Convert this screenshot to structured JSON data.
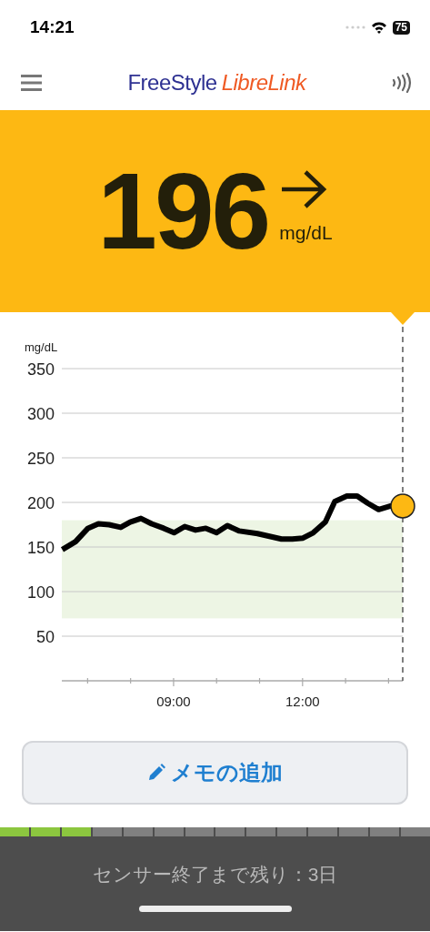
{
  "status_bar": {
    "time": "14:21",
    "battery": "75"
  },
  "header": {
    "logo_primary": "FreeStyle",
    "logo_secondary": "LibreLink"
  },
  "reading": {
    "value": "196",
    "unit": "mg/dL"
  },
  "chart": {
    "chart_data": {
      "type": "line",
      "ylabel": "mg/dL",
      "xlim": [
        6.4,
        14.33
      ],
      "ylim": [
        0,
        350
      ],
      "xticks": [
        {
          "value": 9,
          "label": "09:00"
        },
        {
          "value": 12,
          "label": "12:00"
        }
      ],
      "yticks": [
        50,
        100,
        150,
        200,
        250,
        300,
        350
      ],
      "x": [
        6.41,
        6.72,
        7.01,
        7.25,
        7.5,
        7.77,
        7.99,
        8.24,
        8.49,
        8.77,
        9.01,
        9.26,
        9.51,
        9.75,
        10.0,
        10.25,
        10.53,
        10.95,
        11.23,
        11.51,
        11.76,
        12.01,
        12.25,
        12.53,
        12.75,
        13.03,
        13.27,
        13.52,
        13.77,
        14.05,
        14.33
      ],
      "grid": true,
      "series": [
        {
          "color": "#000000",
          "values": [
            147,
            156,
            171,
            176,
            175,
            172,
            178,
            182,
            176,
            171,
            166,
            173,
            169,
            171,
            166,
            174,
            168,
            165,
            162,
            159,
            159,
            160,
            166,
            178,
            201,
            207,
            207,
            199,
            192,
            196,
            196
          ]
        }
      ],
      "bands": [
        {
          "axis": "y",
          "from": 70,
          "to": 180
        }
      ]
    }
  },
  "memo_button": {
    "label": "メモの追加"
  },
  "sensor": {
    "segments": [
      {
        "used": true
      },
      {
        "used": true
      },
      {
        "used": true
      },
      {
        "used": false
      },
      {
        "used": false
      },
      {
        "used": false
      },
      {
        "used": false
      },
      {
        "used": false
      },
      {
        "used": false
      },
      {
        "used": false
      },
      {
        "used": false
      },
      {
        "used": false
      },
      {
        "used": false
      },
      {
        "used": false
      }
    ],
    "remaining": "センサー終了まで残り：3日"
  }
}
